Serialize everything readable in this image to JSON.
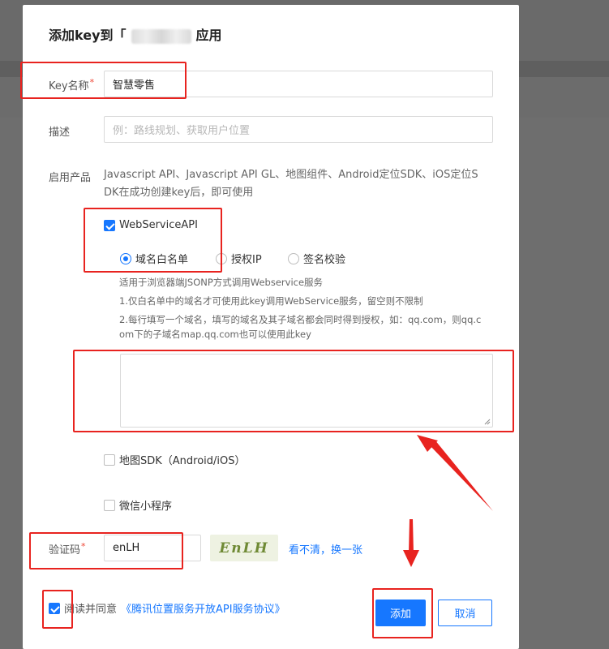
{
  "dialog": {
    "title_prefix": "添加key到「",
    "title_suffix": "应用"
  },
  "form": {
    "key_name": {
      "label": "Key名称",
      "required_mark": "*",
      "value": "智慧零售"
    },
    "description": {
      "label": "描述",
      "placeholder": "例：路线规划、获取用户位置"
    },
    "products": {
      "label": "启用产品",
      "intro_line1": "Javascript API、Javascript API GL、地图组件、Android定位SDK、iOS定位S",
      "intro_line2": "DK在成功创建key后，即可使用",
      "webservice": {
        "label": "WebServiceAPI",
        "checked": true,
        "options": [
          {
            "label": "域名白名单",
            "selected": true
          },
          {
            "label": "授权IP",
            "selected": false
          },
          {
            "label": "签名校验",
            "selected": false
          }
        ],
        "help": [
          "适用于浏览器端JSONP方式调用Webservice服务",
          "1.仅白名单中的域名才可使用此key调用WebService服务，留空则不限制",
          "2.每行填写一个域名，填写的域名及其子域名都会同时得到授权，如：qq.com，则qq.c",
          "om下的子域名map.qq.com也可以使用此key"
        ],
        "textarea_value": ""
      },
      "map_sdk": {
        "label": "地图SDK（Android/iOS）",
        "checked": false
      },
      "wechat": {
        "label": "微信小程序",
        "checked": false
      }
    },
    "captcha": {
      "label": "验证码",
      "required_mark": "*",
      "value": "enLH",
      "image_text": "EnLH",
      "refresh_link": "看不清，换一张"
    },
    "agreement": {
      "checked": true,
      "text": "阅读并同意",
      "link": "《腾讯位置服务开放API服务协议》"
    }
  },
  "buttons": {
    "add": "添加",
    "cancel": "取消"
  },
  "colors": {
    "primary": "#1677ff",
    "annotation_red": "#e8231f"
  }
}
